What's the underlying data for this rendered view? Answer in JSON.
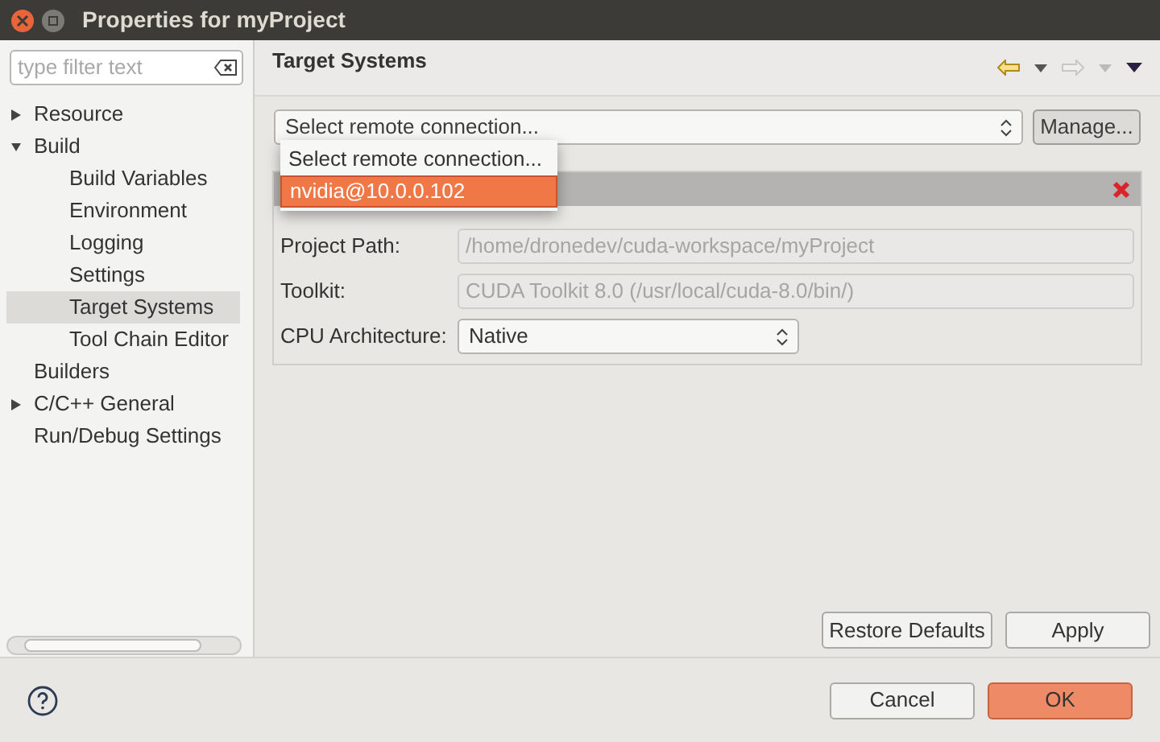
{
  "window": {
    "title": "Properties for myProject"
  },
  "sidebar": {
    "filter": {
      "placeholder": "type filter text"
    },
    "tree": [
      {
        "label": "Resource",
        "expanded": false,
        "selected": false
      },
      {
        "label": "Build",
        "expanded": true,
        "selected": false,
        "children": [
          {
            "label": "Build Variables",
            "selected": false
          },
          {
            "label": "Environment",
            "selected": false
          },
          {
            "label": "Logging",
            "selected": false
          },
          {
            "label": "Settings",
            "selected": false
          },
          {
            "label": "Target Systems",
            "selected": true
          },
          {
            "label": "Tool Chain Editor",
            "selected": false
          }
        ]
      },
      {
        "label": "Builders",
        "selected": false
      },
      {
        "label": "C/C++ General",
        "expanded": false,
        "selected": false
      },
      {
        "label": "Run/Debug Settings",
        "selected": false
      }
    ]
  },
  "page": {
    "title": "Target Systems",
    "connection": {
      "value": "Select remote connection...",
      "expanded": true,
      "options": [
        {
          "label": "Select remote connection...",
          "highlighted": false
        },
        {
          "label": "nvidia@10.0.0.102",
          "highlighted": true
        }
      ]
    },
    "manage_button": "Manage...",
    "form": [
      {
        "kind": "text",
        "label": "Project Path:",
        "value": "/home/dronedev/cuda-workspace/myProject",
        "disabled": true
      },
      {
        "kind": "text",
        "label": "Toolkit:",
        "value": "CUDA Toolkit 8.0 (/usr/local/cuda-8.0/bin/)",
        "disabled": true
      },
      {
        "kind": "select",
        "label": "CPU Architecture:",
        "value": "Native",
        "disabled": false
      }
    ],
    "buttons": [
      "Restore Defaults",
      "Apply"
    ]
  },
  "footer": {
    "buttons": [
      {
        "label": "Cancel",
        "default": false
      },
      {
        "label": "OK",
        "default": true
      }
    ]
  }
}
